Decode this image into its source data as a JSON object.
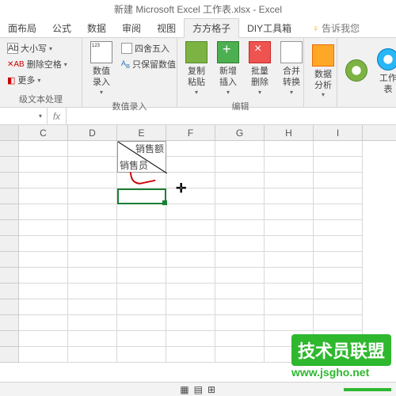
{
  "title": "新建 Microsoft Excel 工作表.xlsx - Excel",
  "tabs": [
    "面布局",
    "公式",
    "数据",
    "审阅",
    "视图",
    "方方格子",
    "DIY工具箱"
  ],
  "active_tab_index": 5,
  "tell_me": "告诉我您",
  "ribbon": {
    "text_group": {
      "case": "大小写",
      "del_space": "删除空格",
      "more": "更多",
      "label": "级文本处理"
    },
    "num_group": {
      "input": "数值录入",
      "round": "四舍五入",
      "keep": "只保留数值",
      "label": "数值录入"
    },
    "edit_group": {
      "copy": "复制粘贴",
      "insert": "新增插入",
      "delete": "批量删除",
      "merge": "合并转换",
      "label": "编辑"
    },
    "analysis": {
      "btn": "数据分析"
    },
    "work": {
      "btn": "工作表"
    }
  },
  "formula_bar": {
    "fx": "fx",
    "name": ""
  },
  "columns": [
    "C",
    "D",
    "E",
    "F",
    "G",
    "H",
    "I"
  ],
  "diag_cell": {
    "top_right": "销售额",
    "bottom_left": "销售员"
  },
  "cursor": "✛",
  "watermark": {
    "badge": "技术员联盟",
    "url": "www.jsgho.net"
  },
  "accents": {
    "tab_active_bg": "#f1f1f1",
    "selection": "#1a7f37",
    "brand": "#2eb82e"
  }
}
